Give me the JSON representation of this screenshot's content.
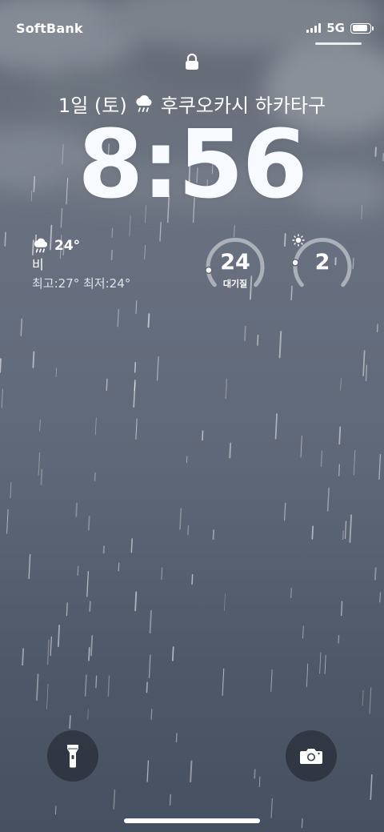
{
  "status": {
    "carrier": "SoftBank",
    "network": "5G",
    "battery_level": 0.9
  },
  "lock_screen": {
    "date": "1일 (토)",
    "location": "후쿠오카시 하카타구",
    "time": "8:56"
  },
  "weather": {
    "icon": "rain-cloud-icon",
    "temperature": "24°",
    "condition": "비",
    "range": "최고:27° 최저:24°"
  },
  "air_quality": {
    "value": "24",
    "label": "대기질",
    "level": 0.12
  },
  "uv_index": {
    "value": "2",
    "icon": "sun-icon",
    "level": 0.18
  },
  "quick_actions": {
    "flashlight": "flashlight-icon",
    "camera": "camera-icon"
  },
  "colors": {
    "background_top": "#5e6470",
    "background_bottom": "#465060",
    "text": "#ffffff",
    "button_bg": "#2a303a"
  }
}
